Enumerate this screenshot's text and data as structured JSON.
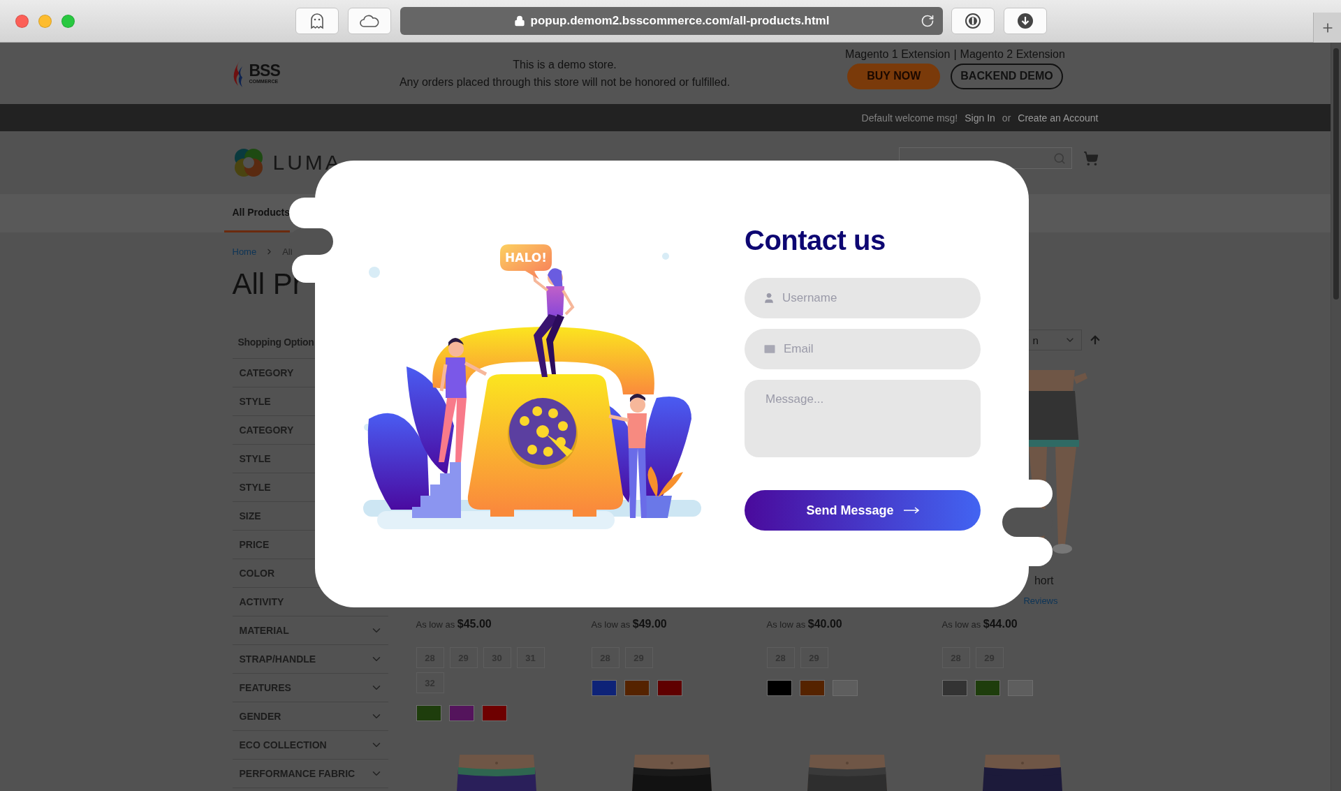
{
  "browser": {
    "url": "popup.demom2.bsscommerce.com/all-products.html"
  },
  "demo_banner": {
    "logo_text": "BSS",
    "logo_subtext": "COMMERCE",
    "notice": [
      "This is a demo store.",
      "Any orders placed through this store will not be honored or fulfilled."
    ],
    "extension_links": [
      "Magento 1 Extension",
      "Magento 2 Extension"
    ],
    "link_separator": "|",
    "buttons": [
      {
        "label": "BUY NOW",
        "kind": "filled"
      },
      {
        "label": "BACKEND DEMO",
        "kind": "outline"
      }
    ]
  },
  "header_links": [
    {
      "label": "Default welcome msg!",
      "kind": "text"
    },
    {
      "label": "Sign In",
      "kind": "link"
    },
    {
      "label": "or",
      "kind": "text"
    },
    {
      "label": "Create an Account",
      "kind": "link"
    }
  ],
  "store_logo": "LUMA",
  "nav": [
    {
      "label": "All Products",
      "selected": true
    }
  ],
  "breadcrumb": [
    "Home",
    "All"
  ],
  "page_title": "All Pr",
  "sidebar": {
    "title": "Shopping Option",
    "filters": [
      {
        "label": "CATEGORY"
      },
      {
        "label": "STYLE"
      },
      {
        "label": "CATEGORY"
      },
      {
        "label": "STYLE"
      },
      {
        "label": "STYLE"
      },
      {
        "label": "SIZE"
      },
      {
        "label": "PRICE"
      },
      {
        "label": "COLOR"
      },
      {
        "label": "ACTIVITY"
      },
      {
        "label": "MATERIAL",
        "toggle_shown": true
      },
      {
        "label": "STRAP/HANDLE",
        "toggle_shown": true
      },
      {
        "label": "FEATURES",
        "toggle_shown": true
      },
      {
        "label": "GENDER",
        "toggle_shown": true
      },
      {
        "label": "ECO COLLECTION",
        "toggle_shown": true
      },
      {
        "label": "PERFORMANCE FABRIC",
        "toggle_shown": true
      }
    ]
  },
  "sorter": {
    "value": "n"
  },
  "products": [
    {
      "price_prefix": "As low as",
      "price": "$45.00",
      "sizes": [
        "28",
        "29",
        "30",
        "31",
        "32"
      ],
      "colors": [
        {
          "color": "#1e3d0c"
        },
        {
          "color": "#54145c"
        },
        {
          "color": "#6e0000"
        }
      ]
    },
    {
      "price_prefix": "As low as",
      "price": "$49.00",
      "sizes": [
        "28",
        "29"
      ],
      "colors": [
        {
          "color": "#0e2378"
        },
        {
          "color": "#552300"
        },
        {
          "color": "#5f0000"
        }
      ]
    },
    {
      "price_prefix": "As low as",
      "price": "$40.00",
      "sizes": [
        "28",
        "29"
      ],
      "colors": [
        {
          "color": "#000000"
        },
        {
          "color": "#552300"
        },
        {
          "color": "#5e5e5e"
        }
      ]
    },
    {
      "image": {
        "kind": "picture"
      },
      "name": "hort",
      "reviews": "Reviews",
      "price_prefix": "As low as",
      "price": "$44.00",
      "sizes": [
        "28",
        "29"
      ],
      "colors": [
        {
          "color": "#333333"
        },
        {
          "color": "#1e3d0c"
        },
        {
          "color": "#5e5e5e"
        }
      ]
    },
    {
      "image": {
        "kind": "picture"
      }
    },
    {
      "image": {
        "kind": "picture"
      }
    },
    {
      "image": {
        "kind": "picture"
      }
    },
    {
      "image": {
        "kind": "picture"
      }
    }
  ],
  "modal": {
    "title": "Contact us",
    "speech_bubble": "HALO!",
    "fields": [
      {
        "kind": "user",
        "placeholder": "Username"
      },
      {
        "kind": "email",
        "placeholder": "Email"
      },
      {
        "kind": "message",
        "placeholder": "Message..."
      }
    ],
    "submit": "Send Message"
  }
}
